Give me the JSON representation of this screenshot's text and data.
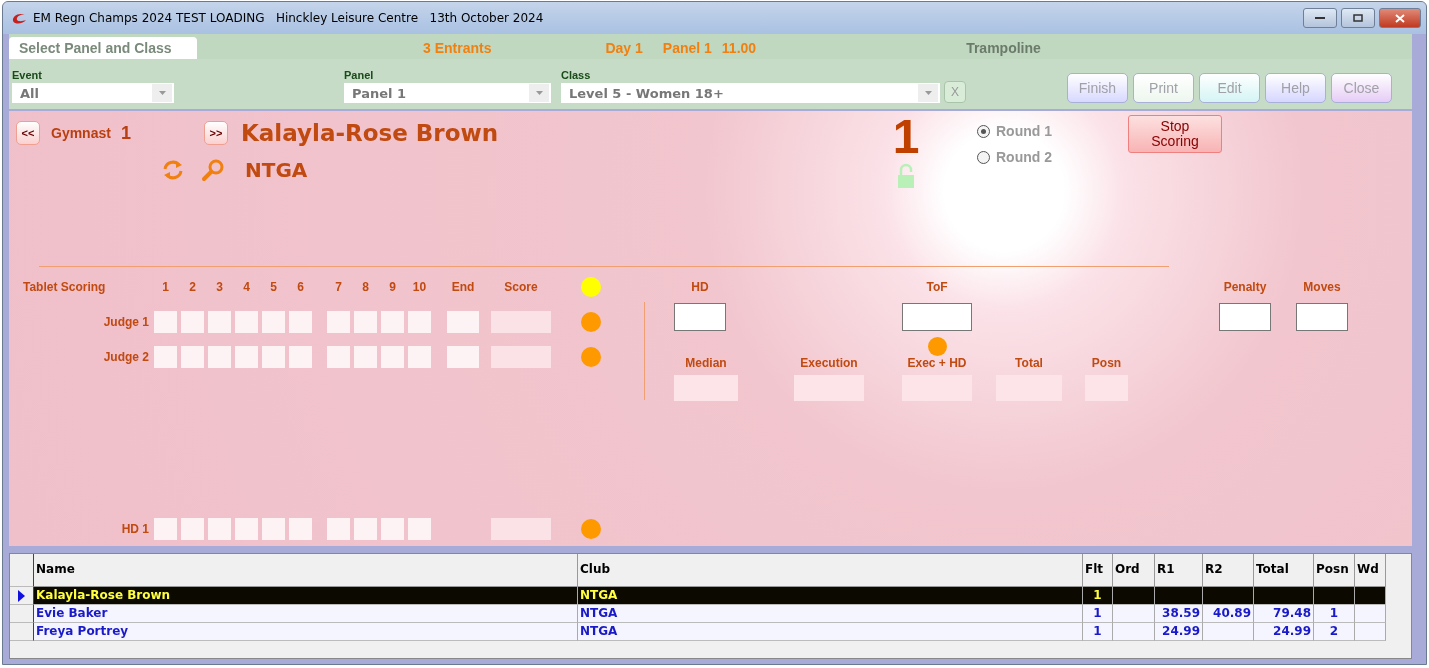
{
  "window": {
    "title": "EM Regn Champs 2024 TEST LOADING   Hinckley Leisure Centre   13th October 2024"
  },
  "header": {
    "tab": "Select Panel and Class",
    "entrants": "3 Entrants",
    "day": "Day 1",
    "panel": "Panel 1",
    "time": "11.00",
    "discipline": "Trampoline"
  },
  "filters": [
    {
      "label": "Event",
      "value": "All"
    },
    {
      "label": "Panel",
      "value": "Panel 1"
    },
    {
      "label": "Class",
      "value": "Level 5 - Women 18+"
    }
  ],
  "clear_button": "X",
  "buttons": [
    {
      "label": "Finish",
      "disabled": true,
      "color": "#d8d8ff"
    },
    {
      "label": "Print",
      "disabled": true,
      "color": "#eef6ee"
    },
    {
      "label": "Edit",
      "disabled": true,
      "color": "#d4f4f4"
    },
    {
      "label": "Help",
      "disabled": true,
      "color": "#d6d6ff"
    },
    {
      "label": "Close",
      "disabled": true,
      "color": "#e6ccf6"
    }
  ],
  "gymnast": {
    "prev": "<<",
    "label": "Gymnast",
    "number": "1",
    "next": ">>",
    "name": "Kalayla-Rose Brown",
    "club": "NTGA"
  },
  "big_number": "1",
  "locked": false,
  "rounds": [
    {
      "label": "Round 1",
      "selected": true
    },
    {
      "label": "Round 2",
      "selected": false
    }
  ],
  "stop_button": "Stop Scoring",
  "scoring": {
    "title": "Tablet Scoring",
    "header_dot": {
      "color": "#ffff00"
    },
    "columns": [
      {
        "label": "1",
        "kind": "throw"
      },
      {
        "label": "2",
        "kind": "throw"
      },
      {
        "label": "3",
        "kind": "throw"
      },
      {
        "label": "4",
        "kind": "throw"
      },
      {
        "label": "5",
        "kind": "throw"
      },
      {
        "label": "6",
        "kind": "throw"
      },
      {
        "label": "7",
        "kind": "throw"
      },
      {
        "label": "8",
        "kind": "throw"
      },
      {
        "label": "9",
        "kind": "throw"
      },
      {
        "label": "10",
        "kind": "throw"
      },
      {
        "label": "End",
        "kind": "end"
      },
      {
        "label": "Score",
        "kind": "score"
      }
    ],
    "rows": [
      {
        "label": "Judge 1",
        "kind": "judge",
        "color": "#ff9900"
      },
      {
        "label": "Judge 2",
        "kind": "judge",
        "color": "#ff9900"
      },
      {
        "label": "HD 1",
        "kind": "hd",
        "color": "#ff9900"
      }
    ]
  },
  "inputs": [
    {
      "label": "HD"
    },
    {
      "label": "ToF",
      "indicator": {
        "color": "#ff9900"
      }
    },
    {
      "label": "Penalty"
    },
    {
      "label": "Moves"
    }
  ],
  "results": [
    {
      "label": "Median"
    },
    {
      "label": "Execution"
    },
    {
      "label": "Exec + HD"
    },
    {
      "label": "Total"
    },
    {
      "label": "Posn"
    }
  ],
  "table": {
    "columns": [
      "Name",
      "Club",
      "Flt",
      "Ord",
      "R1",
      "R2",
      "Total",
      "Posn",
      "Wd"
    ],
    "rows": [
      {
        "selected": true,
        "cells": [
          "Kalayla-Rose Brown",
          "NTGA",
          "1",
          "",
          "",
          "",
          "",
          "",
          ""
        ]
      },
      {
        "selected": false,
        "cells": [
          "Evie Baker",
          "NTGA",
          "1",
          "",
          "38.59",
          "40.89",
          "79.48",
          "1",
          ""
        ]
      },
      {
        "selected": false,
        "cells": [
          "Freya Portrey",
          "NTGA",
          "1",
          "",
          "24.99",
          "",
          "24.99",
          "2",
          ""
        ]
      }
    ]
  }
}
